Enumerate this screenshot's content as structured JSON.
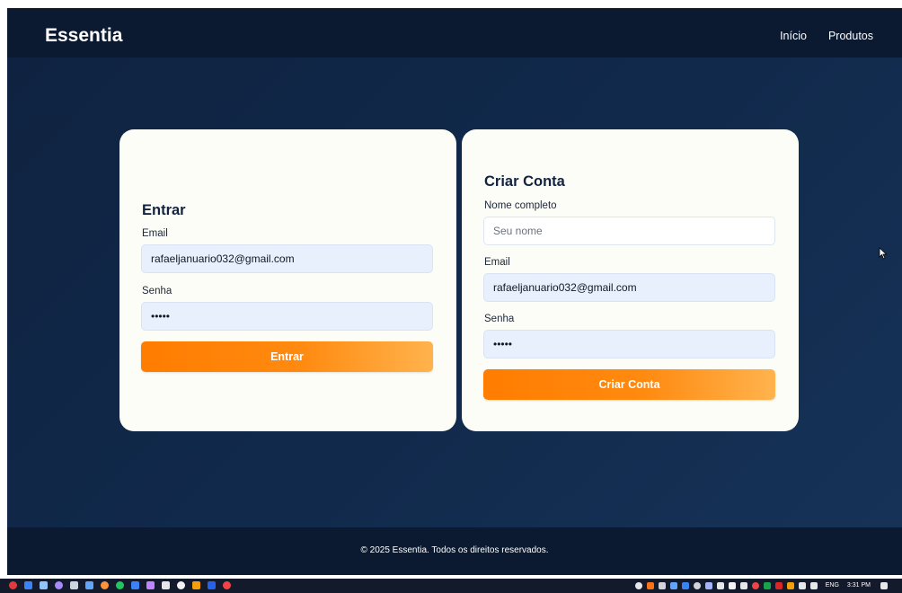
{
  "nav": {
    "brand": "Essentia",
    "links": [
      "Início",
      "Produtos"
    ]
  },
  "login": {
    "title": "Entrar",
    "email_label": "Email",
    "email_value": "rafaeljanuario032@gmail.com",
    "password_label": "Senha",
    "password_value": "12345",
    "submit_label": "Entrar"
  },
  "register": {
    "title": "Criar Conta",
    "name_label": "Nome completo",
    "name_placeholder": "Seu nome",
    "email_label": "Email",
    "email_value": "rafaeljanuario032@gmail.com",
    "password_label": "Senha",
    "password_value": "12345",
    "submit_label": "Criar Conta"
  },
  "footer": {
    "text": "© 2025 Essentia. Todos os direitos reservados."
  },
  "taskbar": {
    "language": "ENG",
    "time": "3:31 PM"
  },
  "colors": {
    "accent": "#ff7d00",
    "navbar": "#0b1a31",
    "card": "#fdfdf7"
  }
}
